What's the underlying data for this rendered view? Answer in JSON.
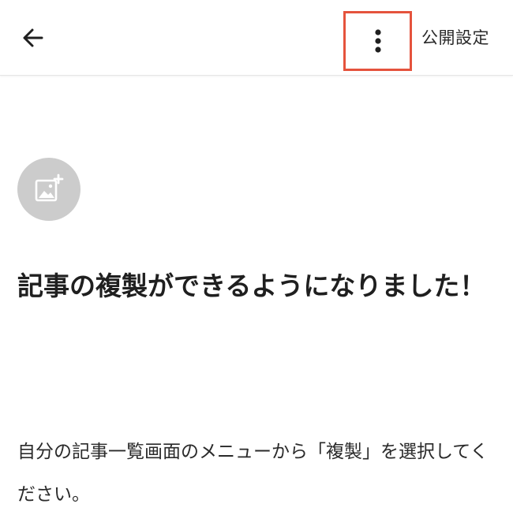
{
  "header": {
    "back_icon": "arrow-left-icon",
    "more_icon": "vertical-dots-icon",
    "publish_label": "公開設定",
    "highlight_color": "#e5533d"
  },
  "editor": {
    "cover_icon": "add-image-icon",
    "title": "記事の複製ができるようになりました！",
    "body": "自分の記事一覧画面のメニューから「複製」を選択してください。"
  }
}
